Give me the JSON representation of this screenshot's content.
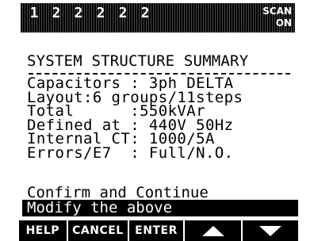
{
  "status": {
    "steps": [
      "1",
      "2",
      "2",
      "2",
      "2",
      "2"
    ],
    "scan_label": "SCAN",
    "on_label": "ON"
  },
  "screen": {
    "title": "SYSTEM STRUCTURE SUMMARY",
    "summary": [
      "Capacitors : 3ph DELTA",
      "Layout:6 groups/11steps",
      "Total      :550kVAr",
      "Defined at : 440V 50Hz",
      "Internal CT: 1000/5A",
      "Errors/E7  : Full/N.O."
    ],
    "options": {
      "confirm": "Confirm and Continue",
      "modify": "Modify the above"
    }
  },
  "softkeys": {
    "help": "HELP",
    "cancel": "CANCEL",
    "enter": "ENTER",
    "up_icon": "arrow-up-icon",
    "down_icon": "arrow-down-icon"
  },
  "colors": {
    "background": "#ffffff",
    "foreground": "#000000",
    "inverse_text": "#ffffff"
  }
}
